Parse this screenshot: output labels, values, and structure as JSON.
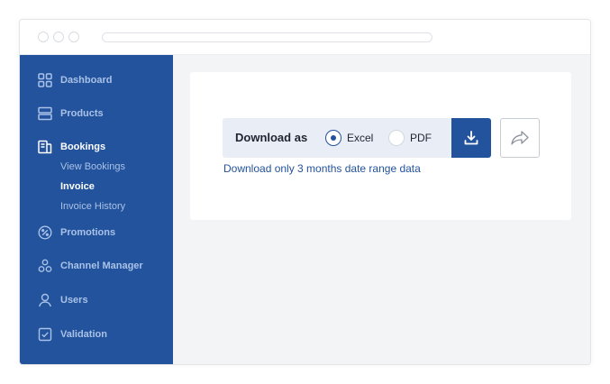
{
  "sidebar": {
    "items": [
      {
        "label": "Dashboard",
        "icon": "grid-icon"
      },
      {
        "label": "Products",
        "icon": "products-icon"
      },
      {
        "label": "Bookings",
        "icon": "bookings-icon",
        "active": true
      },
      {
        "label": "Promotions",
        "icon": "percent-icon"
      },
      {
        "label": "Channel Manager",
        "icon": "channel-icon"
      },
      {
        "label": "Users",
        "icon": "user-icon"
      },
      {
        "label": "Validation",
        "icon": "checkbox-icon"
      }
    ],
    "sub_items": [
      {
        "label": "View Bookings"
      },
      {
        "label": "Invoice",
        "active": true
      },
      {
        "label": "Invoice History"
      }
    ]
  },
  "download": {
    "title": "Download as",
    "options": [
      {
        "label": "Excel",
        "checked": true
      },
      {
        "label": "PDF",
        "checked": false
      }
    ],
    "download_icon": "download-icon",
    "share_icon": "share-icon",
    "hint": "Download only 3 months date range data"
  },
  "colors": {
    "primary": "#23539c",
    "sidebar_text": "#a9c2e8",
    "background": "#f3f4f6"
  }
}
